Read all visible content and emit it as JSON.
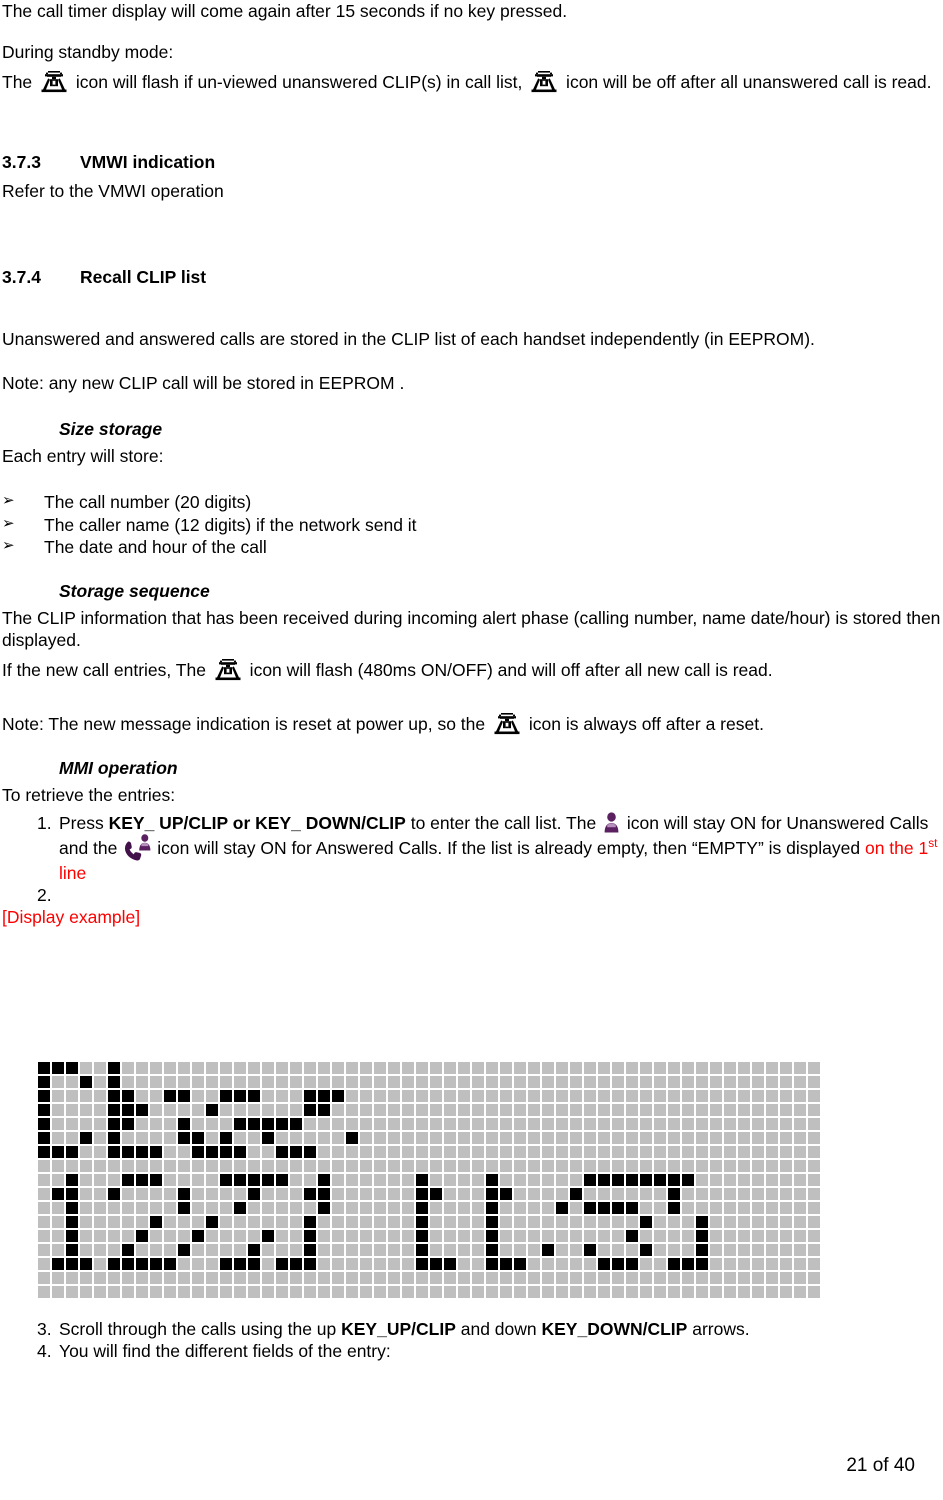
{
  "document": {
    "page_footer": "21 of 40"
  },
  "icons": {
    "telephone": "telephone-icon",
    "person": "person-icon",
    "answered_call": "answered-call-icon",
    "bullet_arrow": "➢"
  },
  "colors": {
    "red_highlight": "#ff0000",
    "icon_purple": "#5b2060",
    "lcd_off": "#bfbfbf",
    "lcd_on": "#000000"
  },
  "content": {
    "p_call_timer": "The call timer display will come again after 15 seconds if no key pressed.",
    "p_standby_label": "During standby mode:",
    "p_standby_a": "The ",
    "p_standby_b": " icon will flash if un-viewed unanswered CLIP(s) in call list, ",
    "p_standby_c": " icon will be off after all unanswered call is read.",
    "h_373_num": "3.7.3",
    "h_373_title": "VMWI indication",
    "p_vmwi": "Refer to the VMWI operation",
    "h_374_num": "3.7.4",
    "h_374_title": "Recall CLIP list",
    "p_unanswered": "Unanswered and answered calls are stored in the CLIP list of each handset independently (in EEPROM).",
    "p_note_eeprom": "Note: any new CLIP call will be stored in EEPROM .",
    "sub_size_storage": "Size storage",
    "p_each_entry": "Each entry will store:",
    "bullets": [
      "The call number (20 digits)",
      "The caller name (12 digits) if the network send it",
      "The date and hour of the call"
    ],
    "sub_storage_sequence": "Storage sequence",
    "p_clip_info": "The CLIP information that has been received during incoming alert phase (calling number, name date/hour) is stored then displayed.",
    "p_newcall_a": "If the new call entries, The ",
    "p_newcall_b": " icon will flash (480ms ON/OFF) and will off after all new call is read.",
    "p_note_reset_a": "Note: The new message indication is reset at power up, so the ",
    "p_note_reset_b": " icon is always off after a reset.",
    "sub_mmi_operation": "MMI operation",
    "p_to_retrieve": "To retrieve the entries:",
    "step1": {
      "index": "1.",
      "t1": "Press ",
      "t2_bold": "KEY_ UP/CLIP or KEY_ DOWN/CLIP",
      "t3": " to enter the call list. The ",
      "t4": " icon will stay ON for Unanswered Calls and the ",
      "t5": "icon will stay ON for Answered Calls.  If the list is already empty, then “EMPTY” is displayed ",
      "t6_red": "on the 1",
      "t6_red_sup": "st",
      "t6_red_tail": " line"
    },
    "step2": {
      "index": "2.",
      "text": ""
    },
    "display_example_label": "[Display example]",
    "step3": {
      "index": "3.",
      "t1": "Scroll through the calls using the up ",
      "t2_bold": "KEY_UP/CLIP",
      "t3": " and down ",
      "t4_bold": "KEY_DOWN/CLIP",
      "t5": " arrows."
    },
    "step4": {
      "index": "4.",
      "text": "You will find the different fields of the entry:"
    }
  },
  "lcd": {
    "columns": 56,
    "rows": 17,
    "line1_text": "ROY",
    "line2_text": "12/01  11:53",
    "pattern": [
      "11100100000000000000000000000000000000000000000000000000",
      "10010100000000000000000000000000000000000000000000000000",
      "10000110011001110001110000000000000000000000000000000000",
      "10000111000010000001100000000000000000000000000000000000",
      "10000110001000111110000000000000000000000000000000000000",
      "10010100001101001000001000000000000000000000000000000000",
      "11100111100111100111000000000000000000000000000000000000",
      "00000000000000000000000000000000000000000000000000000000",
      "00100011100001111100100000010000100000011111111000000000",
      "01100100001000010001100000011000110000100000010000000000",
      "00100000001000100000100000010000100001011110010000000000",
      "00100000100010000001000000010000100000000001000100000000",
      "00100001000100001001000000010000100000000010000100000000",
      "00100010001000010001000000010000100010010001000100000000",
      "01110111110001110111000000011100111000001110011100000000",
      "00000000000000000000000000000000000000000000000000000000",
      "00000000000000000000000000000000000000000000000000000000"
    ]
  }
}
